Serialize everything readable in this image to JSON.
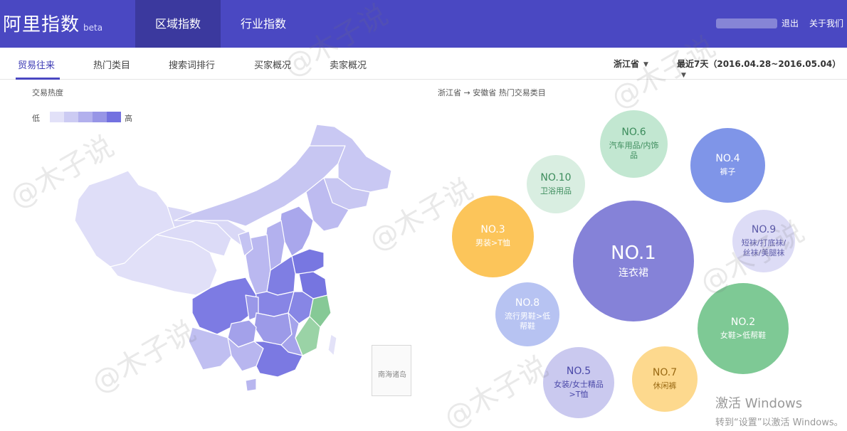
{
  "header": {
    "brand": "阿里指数",
    "brand_sub": "beta",
    "tabs": [
      {
        "label": "区域指数",
        "active": true
      },
      {
        "label": "行业指数",
        "active": false
      }
    ],
    "logout": "退出",
    "about": "关于我们"
  },
  "subnav": {
    "items": [
      {
        "label": "贸易往来",
        "active": true
      },
      {
        "label": "热门类目",
        "active": false
      },
      {
        "label": "搜索词排行",
        "active": false
      },
      {
        "label": "买家概况",
        "active": false
      },
      {
        "label": "卖家概况",
        "active": false
      }
    ],
    "province": "浙江省",
    "date_range": "最近7天（2016.04.28~2016.05.04）"
  },
  "left_panel": {
    "title": "交易热度",
    "legend_low": "低",
    "legend_high": "高",
    "legend_colors": [
      "#e2e1f8",
      "#cccbf3",
      "#b2b0ed",
      "#9795e6",
      "#7371e0"
    ],
    "inset_label": "南海诸岛"
  },
  "right_panel": {
    "title": "浙江省 → 安徽省 热门交易类目",
    "bubbles": [
      {
        "rank": "NO.1",
        "category": "连衣裙",
        "color": "#8582d8",
        "text_color": "#ffffff"
      },
      {
        "rank": "NO.2",
        "category": "女鞋>低帮鞋",
        "color": "#7ec995",
        "text_color": "#ffffff"
      },
      {
        "rank": "NO.3",
        "category": "男装>T恤",
        "color": "#fcc55a",
        "text_color": "#ffffff"
      },
      {
        "rank": "NO.4",
        "category": "裤子",
        "color": "#7f95e8",
        "text_color": "#ffffff"
      },
      {
        "rank": "NO.5",
        "category": "女装/女士精品>T恤",
        "color": "#cac9ef",
        "text_color": "#4a48a8"
      },
      {
        "rank": "NO.6",
        "category": "汽车用品/内饰品",
        "color": "#c2e7d1",
        "text_color": "#3c8c5c"
      },
      {
        "rank": "NO.7",
        "category": "休闲裤",
        "color": "#fdd98e",
        "text_color": "#9a6a14"
      },
      {
        "rank": "NO.8",
        "category": "流行男鞋>低帮鞋",
        "color": "#b7c3f2",
        "text_color": "#ffffff"
      },
      {
        "rank": "NO.9",
        "category": "短袜/打底袜/丝袜/美腿袜",
        "color": "#dddcf6",
        "text_color": "#5c5aa8"
      },
      {
        "rank": "NO.10",
        "category": "卫浴用品",
        "color": "#d9eee1",
        "text_color": "#3c8c5c"
      }
    ]
  },
  "watermark": "@木子说",
  "activate_windows": {
    "line1": "激活 Windows",
    "line2": "转到“设置”以激活 Windows。"
  }
}
